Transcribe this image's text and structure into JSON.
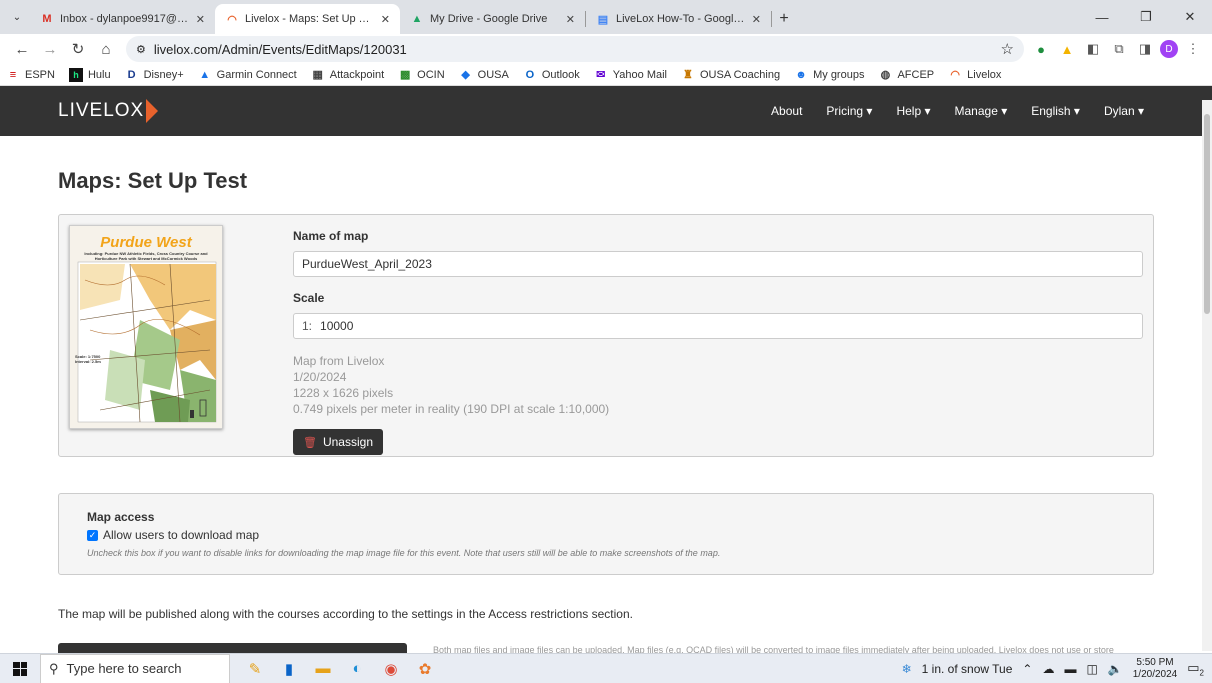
{
  "browser": {
    "tabs": [
      {
        "title": "Inbox - dylanpoe9917@gmail.c",
        "icon": "gmail-icon",
        "active": false
      },
      {
        "title": "Livelox - Maps: Set Up Test",
        "icon": "livelox-icon",
        "active": true
      },
      {
        "title": "My Drive - Google Drive",
        "icon": "drive-icon",
        "active": false
      },
      {
        "title": "LiveLox How-To - Google Docs",
        "icon": "docs-icon",
        "active": false
      }
    ],
    "url": "livelox.com/Admin/Events/EditMaps/120031",
    "profile_initial": "D",
    "bookmarks": [
      "ESPN",
      "Hulu",
      "Disney+",
      "Garmin Connect",
      "Attackpoint",
      "OCIN",
      "OUSA",
      "Outlook",
      "Yahoo Mail",
      "OUSA Coaching",
      "My groups",
      "AFCEP",
      "Livelox"
    ]
  },
  "site": {
    "logo": "LIVELOX",
    "nav": [
      "About",
      "Pricing ▾",
      "Help ▾",
      "Manage ▾",
      "English ▾",
      "Dylan ▾"
    ]
  },
  "page": {
    "title": "Maps: Set Up Test",
    "thumbnail": {
      "title": "Purdue West",
      "subtitle": "Including: Purdue NW Athletic Fields, Cross Country Course and Horticulture Park with Stewart and McCormick Woods",
      "scale_text": "Scale: 1:7500",
      "interval_text": "Interval: 2.5m"
    },
    "name_label": "Name of map",
    "name_value": "PurdueWest_April_2023",
    "scale_label": "Scale",
    "scale_prefix": "1:",
    "scale_value": "10000",
    "info": [
      "Map from Livelox",
      "1/20/2024",
      "1228 x 1626 pixels",
      "0.749 pixels per meter in reality (190 DPI at scale 1:10,000)"
    ],
    "unassign_label": "Unassign",
    "access": {
      "title": "Map access",
      "checkbox_label": "Allow users to download map",
      "checked": true,
      "hint": "Uncheck this box if you want to disable links for downloading the map image file for this event. Note that users still will be able to make screenshots of the map."
    },
    "publish_text": "The map will be published along with the courses according to the settings in the Access restrictions section.",
    "upload_note": "Both map files and image files can be uploaded. Map files (e.g. OCAD files) will be converted to image files immediately after being uploaded. Livelox does not use or store"
  },
  "taskbar": {
    "search_placeholder": "Type here to search",
    "weather": "1 in. of snow Tue",
    "time": "5:50 PM",
    "date": "1/20/2024",
    "notification_count": "2"
  }
}
